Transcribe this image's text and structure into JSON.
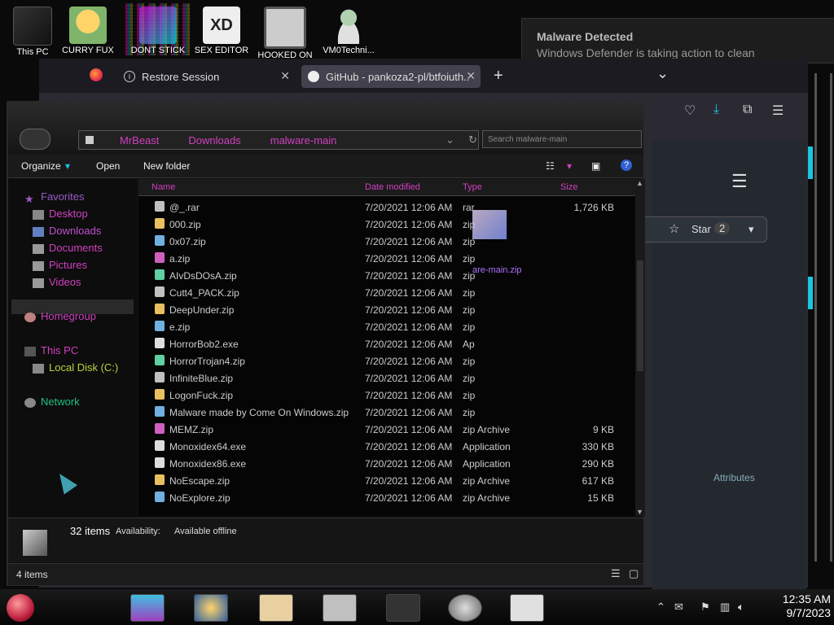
{
  "desktop": {
    "icons": [
      {
        "label": "This PC"
      },
      {
        "label": "CURRY FUX"
      },
      {
        "label": "DONT STICK"
      },
      {
        "label": "SEX EDITOR"
      },
      {
        "label": "HOOKED ON"
      },
      {
        "label": "VM0Techni..."
      }
    ]
  },
  "notification": {
    "title": "Malware Detected",
    "message": "Windows Defender is taking action to clean"
  },
  "browser": {
    "tabs": [
      {
        "label": "Restore Session",
        "close": "✕"
      },
      {
        "label": "GitHub - pankoza2-pl/btfoiuth...",
        "close": "✕"
      }
    ],
    "new_tab": "+",
    "list_tabs": "⌄",
    "github": {
      "star_label": "Star",
      "star_count": "2",
      "attributes_label": "Attributes"
    }
  },
  "explorer": {
    "address": {
      "parts": [
        "MrBeast",
        "Downloads",
        "malware-main"
      ]
    },
    "search_placeholder": "Search malware-main",
    "commands": {
      "organize": "Organize",
      "open": "Open",
      "new_folder": "New folder"
    },
    "nav": {
      "favorites": "Favorites",
      "desktop": "Desktop",
      "downloads": "Downloads",
      "documents": "Documents",
      "pictures": "Pictures",
      "videos": "Videos",
      "homegroup": "Homegroup",
      "this_pc": "This PC",
      "local_disk": "Local Disk (C:)",
      "network": "Network"
    },
    "columns": {
      "name": "Name",
      "date": "Date modified",
      "type": "Type",
      "size": "Size"
    },
    "files": [
      {
        "name": "@_.rar",
        "date": "7/20/2021 12:06 AM",
        "type": "rar",
        "size": "1,726 KB"
      },
      {
        "name": "000.zip",
        "date": "7/20/2021 12:06 AM",
        "type": "zip",
        "size": ""
      },
      {
        "name": "0x07.zip",
        "date": "7/20/2021 12:06 AM",
        "type": "zip",
        "size": ""
      },
      {
        "name": "a.zip",
        "date": "7/20/2021 12:06 AM",
        "type": "zip",
        "size": ""
      },
      {
        "name": "AIvDsDOsA.zip",
        "date": "7/20/2021 12:06 AM",
        "type": "zip",
        "size": ""
      },
      {
        "name": "Cutt4_PACK.zip",
        "date": "7/20/2021 12:06 AM",
        "type": "zip",
        "size": ""
      },
      {
        "name": "DeepUnder.zip",
        "date": "7/20/2021 12:06 AM",
        "type": "zip",
        "size": ""
      },
      {
        "name": "e.zip",
        "date": "7/20/2021 12:06 AM",
        "type": "zip",
        "size": ""
      },
      {
        "name": "HorrorBob2.exe",
        "date": "7/20/2021 12:06 AM",
        "type": "Ap",
        "size": ""
      },
      {
        "name": "HorrorTrojan4.zip",
        "date": "7/20/2021 12:06 AM",
        "type": "zip",
        "size": ""
      },
      {
        "name": "InfiniteBlue.zip",
        "date": "7/20/2021 12:06 AM",
        "type": "zip",
        "size": ""
      },
      {
        "name": "LogonFuck.zip",
        "date": "7/20/2021 12:06 AM",
        "type": "zip",
        "size": ""
      },
      {
        "name": "Malware made by Come On Windows.zip",
        "date": "7/20/2021 12:06 AM",
        "type": "zip",
        "size": ""
      },
      {
        "name": "MEMZ.zip",
        "date": "7/20/2021 12:06 AM",
        "type": "zip Archive",
        "size": "9 KB"
      },
      {
        "name": "Monoxidex64.exe",
        "date": "7/20/2021 12:06 AM",
        "type": "Application",
        "size": "330 KB"
      },
      {
        "name": "Monoxidex86.exe",
        "date": "7/20/2021 12:06 AM",
        "type": "Application",
        "size": "290 KB"
      },
      {
        "name": "NoEscape.zip",
        "date": "7/20/2021 12:06 AM",
        "type": "zip Archive",
        "size": "617 KB"
      },
      {
        "name": "NoExplore.zip",
        "date": "7/20/2021 12:06 AM",
        "type": "zip Archive",
        "size": "15 KB"
      }
    ],
    "drag_label": "are-main.zip",
    "details": {
      "count": "32 items",
      "availability_label": "Availability:",
      "availability_value": "Available offline"
    },
    "status": "4 items"
  },
  "taskbar": {
    "time": "12:35 AM",
    "date": "9/7/2023"
  },
  "colors": {
    "accent_cyan": "#19c6e0",
    "accent_magenta": "#d040c0",
    "accent_red": "#e02030"
  }
}
